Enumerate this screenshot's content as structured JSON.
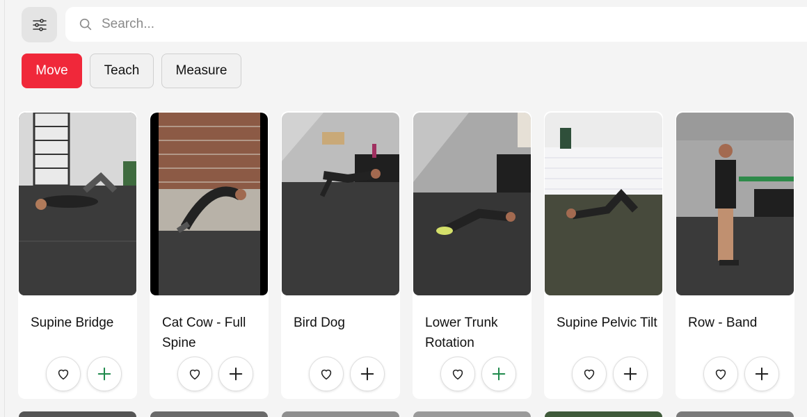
{
  "toolbar": {
    "filter_icon": "sliders-icon",
    "search_icon": "search-icon",
    "search_placeholder": "Search...",
    "search_value": ""
  },
  "tabs": [
    {
      "label": "Move",
      "active": true
    },
    {
      "label": "Teach",
      "active": false
    },
    {
      "label": "Measure",
      "active": false
    }
  ],
  "exercises": [
    {
      "title": "Supine Bridge",
      "added_accent": true
    },
    {
      "title": "Cat Cow - Full Spine",
      "added_accent": false
    },
    {
      "title": "Bird Dog",
      "added_accent": false
    },
    {
      "title": "Lower Trunk Rotation",
      "added_accent": true
    },
    {
      "title": "Supine Pelvic Tilt",
      "added_accent": false
    },
    {
      "title": "Row - Band",
      "added_accent": false
    }
  ],
  "icons": {
    "favorite": "heart-icon",
    "add": "plus-icon"
  },
  "colors": {
    "accent": "#f0283a",
    "plus_green": "#1f8a4c",
    "plus_dark": "#222222"
  }
}
